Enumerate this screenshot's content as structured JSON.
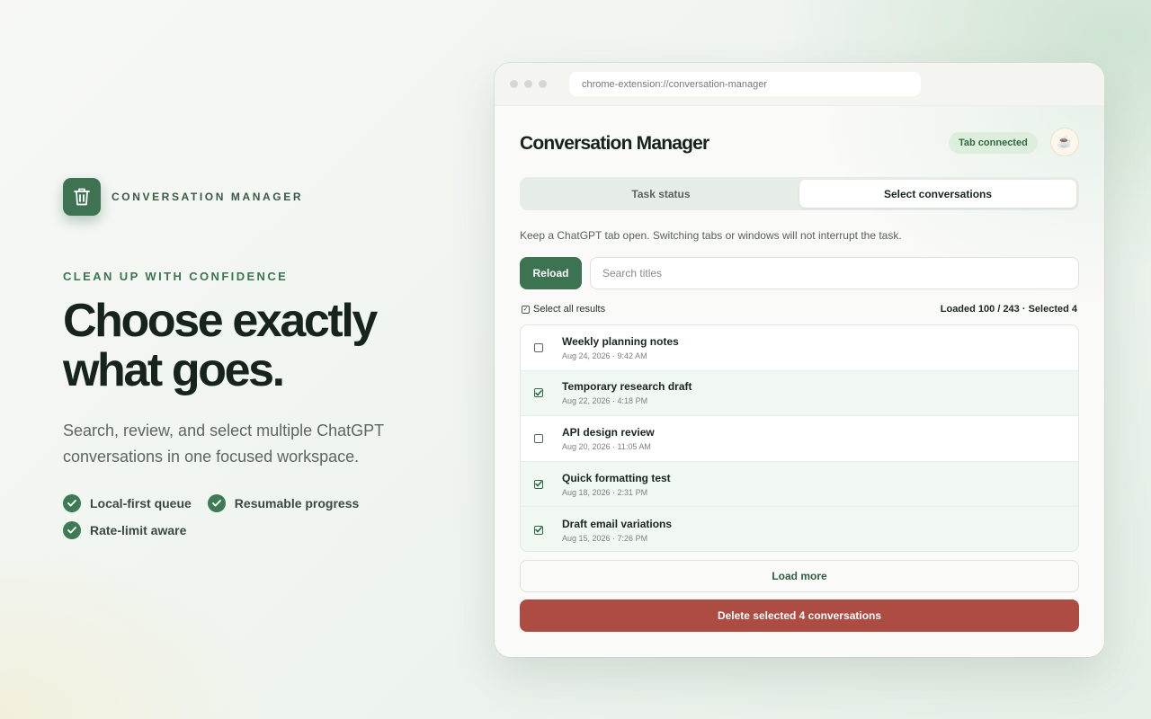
{
  "brand": {
    "name": "CONVERSATION MANAGER",
    "icon": "trash-icon"
  },
  "hero": {
    "eyebrow": "CLEAN UP WITH CONFIDENCE",
    "headline_line1": "Choose exactly",
    "headline_line2": "what goes.",
    "subtitle": "Search, review, and select multiple ChatGPT conversations in one focused workspace.",
    "features": [
      "Local-first queue",
      "Resumable progress",
      "Rate-limit aware"
    ]
  },
  "browser": {
    "url": "chrome-extension://conversation-manager"
  },
  "app": {
    "title": "Conversation Manager",
    "status_pill": "Tab connected",
    "coffee_icon": "coffee-icon",
    "tabs": [
      {
        "label": "Task status",
        "active": false
      },
      {
        "label": "Select conversations",
        "active": true
      }
    ],
    "hint": "Keep a ChatGPT tab open. Switching tabs or windows will not interrupt the task.",
    "reload_label": "Reload",
    "search_placeholder": "Search titles",
    "select_all_label": "Select all results",
    "counts": "Loaded 100 / 243 · Selected 4",
    "conversations": [
      {
        "title": "Weekly planning notes",
        "date": "Aug 24, 2026 · 9:42 AM",
        "selected": false
      },
      {
        "title": "Temporary research draft",
        "date": "Aug 22, 2026 · 4:18 PM",
        "selected": true
      },
      {
        "title": "API design review",
        "date": "Aug 20, 2026 · 11:05 AM",
        "selected": false
      },
      {
        "title": "Quick formatting test",
        "date": "Aug 18, 2026 · 2:31 PM",
        "selected": true
      },
      {
        "title": "Draft email variations",
        "date": "Aug 15, 2026 · 7:26 PM",
        "selected": true
      }
    ],
    "load_more_label": "Load more",
    "delete_label": "Delete selected 4 conversations"
  },
  "colors": {
    "accent": "#3c7351",
    "danger": "#ad4c42",
    "pill_bg": "#ddeedd"
  }
}
